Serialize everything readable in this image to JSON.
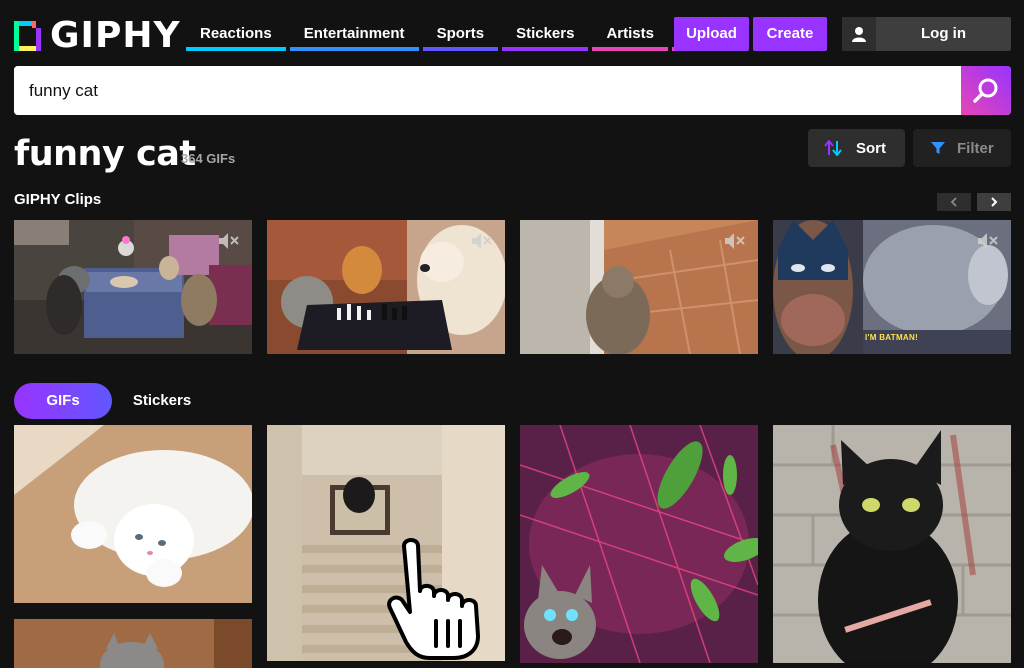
{
  "header": {
    "logo_text": "GIPHY",
    "nav": [
      {
        "label": "Reactions",
        "color": "#00ccff"
      },
      {
        "label": "Entertainment",
        "color": "#3191ff"
      },
      {
        "label": "Sports",
        "color": "#6157ff"
      },
      {
        "label": "Stickers",
        "color": "#9933ff"
      },
      {
        "label": "Artists",
        "color": "#e646b6"
      }
    ],
    "more_icon": "vertical-dots-icon",
    "upload_label": "Upload",
    "create_label": "Create",
    "login_label": "Log in"
  },
  "search": {
    "value": "funny cat",
    "icon": "search-icon"
  },
  "results": {
    "title": "funny cat",
    "count": "364 GIFs",
    "sort_label": "Sort",
    "filter_label": "Filter"
  },
  "clips": {
    "label": "GIPHY Clips",
    "items": [
      {
        "description": "cats at birthday party",
        "muted": true
      },
      {
        "description": "cats and dog playing chess",
        "muted": true
      },
      {
        "description": "cat in doorway",
        "muted": true
      },
      {
        "description": "batman with cat",
        "muted": true,
        "caption": "I'M BATMAN!"
      }
    ]
  },
  "tabs": {
    "gifs_label": "GIFs",
    "stickers_label": "Stickers"
  },
  "colors": {
    "background": "#121212",
    "accent_purple": "#9933ff",
    "button_dark": "#2e2e2e"
  }
}
